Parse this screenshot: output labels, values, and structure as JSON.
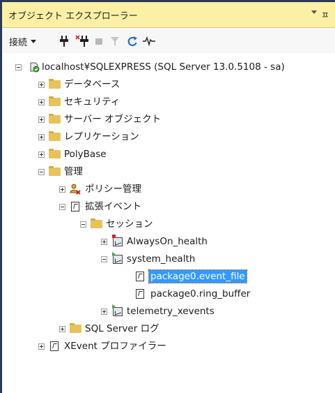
{
  "window": {
    "title": "オブジェクト エクスプローラー",
    "pin_glyph": "ㅍ"
  },
  "toolbar": {
    "connect_label": "接続"
  },
  "tree": [
    {
      "id": "server",
      "label": "localhost¥SQLEXPRESS (SQL Server 13.0.5108 - sa)"
    },
    {
      "id": "databases",
      "label": "データベース"
    },
    {
      "id": "security",
      "label": "セキュリティ"
    },
    {
      "id": "server-objects",
      "label": "サーバー オブジェクト"
    },
    {
      "id": "replication",
      "label": "レプリケーション"
    },
    {
      "id": "polybase",
      "label": "PolyBase"
    },
    {
      "id": "management",
      "label": "管理"
    },
    {
      "id": "policy-management",
      "label": "ポリシー管理"
    },
    {
      "id": "extended-events",
      "label": "拡張イベント"
    },
    {
      "id": "sessions",
      "label": "セッション"
    },
    {
      "id": "alwayson-health",
      "label": "AlwaysOn_health"
    },
    {
      "id": "system-health",
      "label": "system_health"
    },
    {
      "id": "event-file",
      "label": "package0.event_file",
      "selected": true
    },
    {
      "id": "ring-buffer",
      "label": "package0.ring_buffer"
    },
    {
      "id": "telemetry-xevents",
      "label": "telemetry_xevents"
    },
    {
      "id": "sql-server-logs",
      "label": "SQL Server ログ"
    },
    {
      "id": "xevent-profiler",
      "label": "XEvent プロファイラー"
    }
  ],
  "colors": {
    "selection": "#3399ff",
    "title_bar": "#fcf0a6",
    "frame": "#2b3a55",
    "folder": "#e8c25a"
  }
}
